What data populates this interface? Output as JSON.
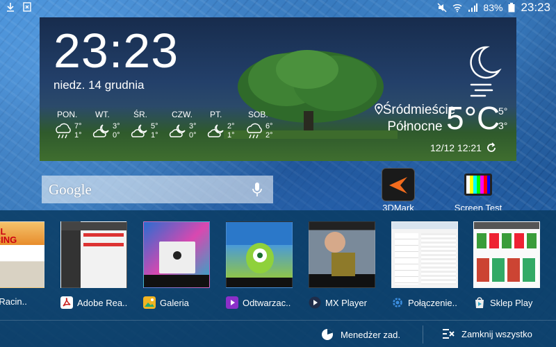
{
  "status_bar": {
    "battery": "83%",
    "time": "23:23",
    "left_icons": [
      "download-icon",
      "sim-card-icon"
    ],
    "right_icons": [
      "mute-icon",
      "wifi-icon",
      "signal-icon",
      "battery-icon"
    ]
  },
  "weather": {
    "clock": "23:23",
    "date": "niedz. 14 grudnia",
    "location_line1": "Śródmieście",
    "location_line2": "Północne",
    "current_temp": "5°C",
    "high": "5°",
    "low": "3°",
    "updated": "12/12 12:21",
    "condition_icon": "moon-fog-icon",
    "forecast": [
      {
        "day": "PON.",
        "high": "7°",
        "low": "1°",
        "icon": "rain-cloud-icon"
      },
      {
        "day": "WT.",
        "high": "3°",
        "low": "0°",
        "icon": "moon-cloud-icon"
      },
      {
        "day": "ŚR.",
        "high": "5°",
        "low": "1°",
        "icon": "moon-cloud-icon"
      },
      {
        "day": "CZW.",
        "high": "3°",
        "low": "0°",
        "icon": "moon-cloud-icon"
      },
      {
        "day": "PT.",
        "high": "2°",
        "low": "1°",
        "icon": "moon-cloud-icon"
      },
      {
        "day": "SOB.",
        "high": "6°",
        "low": "2°",
        "icon": "rain-cloud-icon"
      }
    ]
  },
  "search": {
    "logo": "Google"
  },
  "home_apps": [
    {
      "label": "3DMark"
    },
    {
      "label": "Screen Test"
    }
  ],
  "recents": {
    "apps": [
      {
        "label": "Real Racin..",
        "accent": "#e8a93a"
      },
      {
        "label": "Adobe Rea..",
        "accent": "#c8201e"
      },
      {
        "label": "Galeria",
        "accent": "#f2b422"
      },
      {
        "label": "Odtwarzac..",
        "accent": "#8b2fc9"
      },
      {
        "label": "MX Player",
        "accent": "#2a5fa8"
      },
      {
        "label": "Połączenie..",
        "accent": "#2f7fd6"
      },
      {
        "label": "Sklep Play",
        "accent": "#eeeeee"
      }
    ],
    "task_manager": "Menedżer zad.",
    "close_all": "Zamknij wszystko"
  }
}
